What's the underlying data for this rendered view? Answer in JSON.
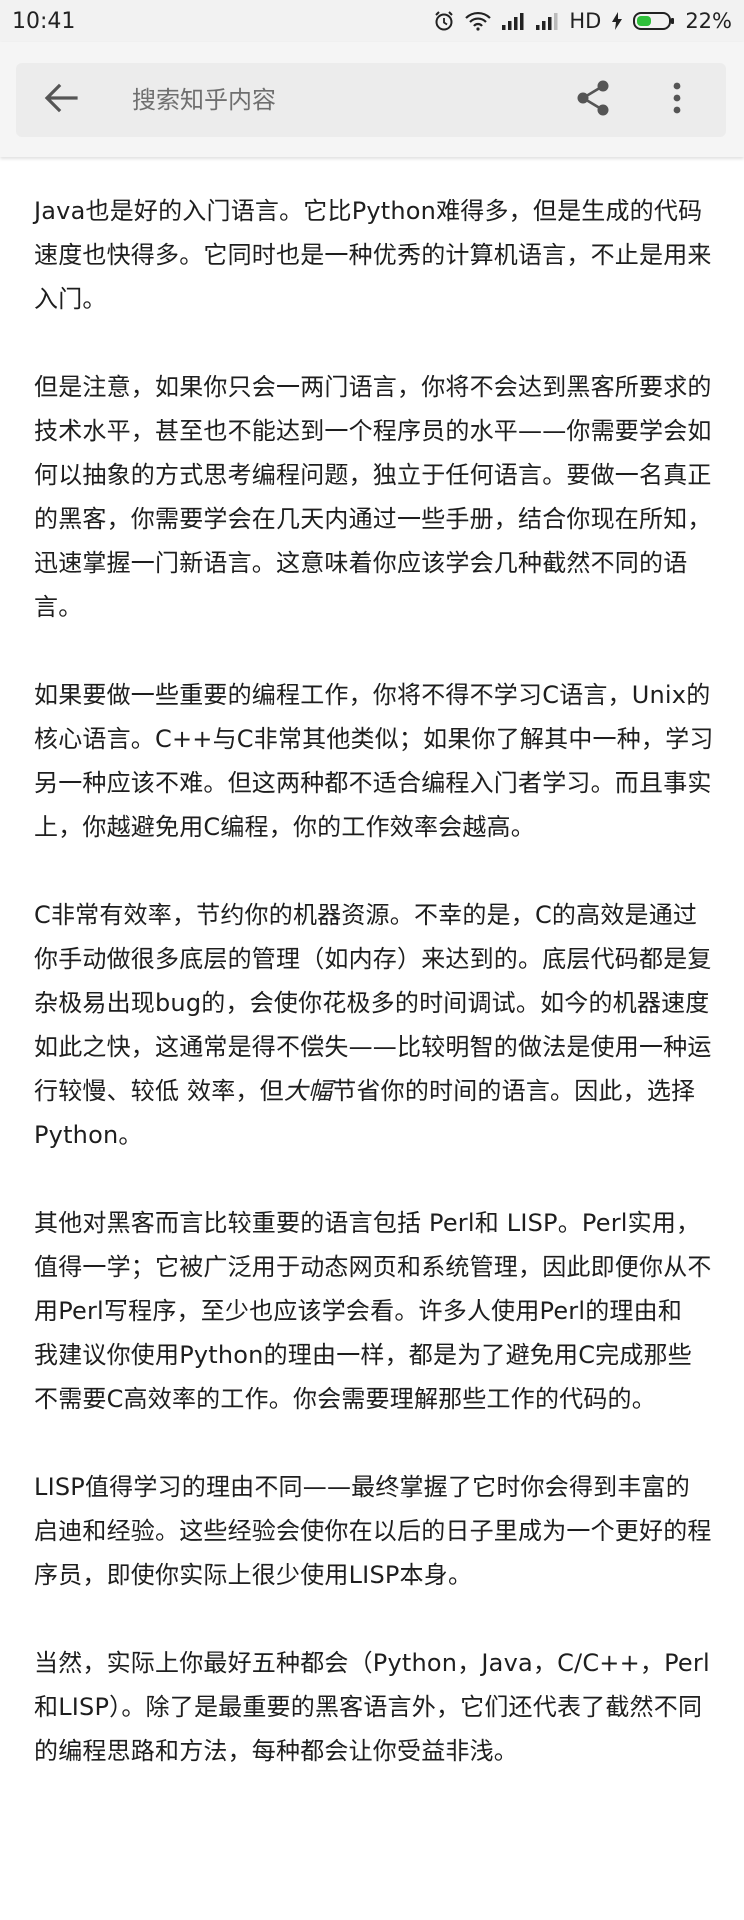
{
  "status_bar": {
    "time": "10:41",
    "network": "HD",
    "battery": "22%"
  },
  "app_bar": {
    "search_placeholder": "搜索知乎内容",
    "icons": {
      "back": "arrow-left-icon",
      "share": "share-icon",
      "more": "more-vert-icon"
    }
  },
  "article": {
    "paragraphs": [
      {
        "text": "Java也是好的入门语言。它比Python难得多，但是生成的代码速度也快得多。它同时也是一种优秀的计算机语言，不止是用来入门。"
      },
      {
        "text": "但是注意，如果你只会一两门语言，你将不会达到黑客所要求的技术水平，甚至也不能达到一个程序员的水平——你需要学会如何以抽象的方式思考编程问题，独立于任何语言。要做一名真正的黑客，你需要学会在几天内通过一些手册，结合你现在所知，迅速掌握一门新语言。这意味着你应该学会几种截然不同的语言。"
      },
      {
        "text": "如果要做一些重要的编程工作，你将不得不学习C语言，Unix的核心语言。C++与C非常其他类似；如果你了解其中一种，学习另一种应该不难。但这两种都不适合编程入门者学习。而且事实上，你越避免用C编程，你的工作效率会越高。"
      },
      {
        "text_before": "C非常有效率，节约你的机器资源。不幸的是，C的高效是通过你手动做很多底层的管理（如内存）来达到的。底层代码都是复杂极易出现bug的，会使你花极多的时间调试。如今的机器速度如此之快，这通常是得不偿失——比较明智的做法是使用一种运行较慢、较低 效率，但",
        "text_italic": "大幅",
        "text_after": "节省你的时间的语言。因此，选择Python。"
      },
      {
        "text": "其他对黑客而言比较重要的语言包括 Perl和 LISP。Perl实用，值得一学；它被广泛用于动态网页和系统管理，因此即便你从不用Perl写程序，至少也应该学会看。许多人使用Perl的理由和 我建议你使用Python的理由一样，都是为了避免用C完成那些不需要C高效率的工作。你会需要理解那些工作的代码的。"
      },
      {
        "text": "LISP值得学习的理由不同——最终掌握了它时你会得到丰富的启迪和经验。这些经验会使你在以后的日子里成为一个更好的程序员，即使你实际上很少使用LISP本身。"
      },
      {
        "text": "当然，实际上你最好五种都会（Python，Java，C/C++，Perl和LISP）。除了是最重要的黑客语言外，它们还代表了截然不同的编程思路和方法，每种都会让你受益非浅。"
      }
    ]
  }
}
